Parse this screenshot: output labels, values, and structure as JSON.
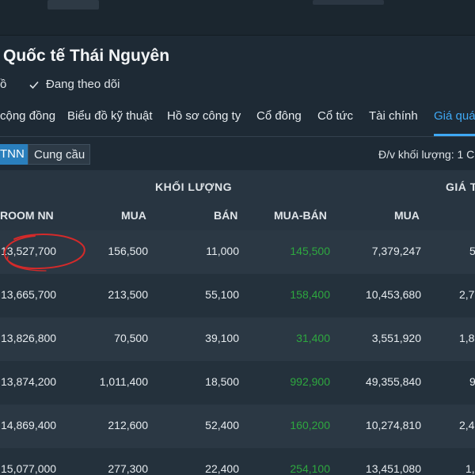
{
  "header": {
    "title": "Quốc tế Thái Nguyên",
    "left_fragment": "ồ",
    "follow_label": "Đang theo dõi"
  },
  "tabs": [
    {
      "label": "cộng đồng",
      "active": false
    },
    {
      "label": "Biểu đồ kỹ thuật",
      "active": false
    },
    {
      "label": "Hồ sơ công ty",
      "active": false
    },
    {
      "label": "Cổ đông",
      "active": false
    },
    {
      "label": "Cổ tức",
      "active": false
    },
    {
      "label": "Tài chính",
      "active": false
    },
    {
      "label": "Giá quá",
      "active": true
    }
  ],
  "segment": {
    "tnn_label": "TNN",
    "cung_cau_label": "Cung cầu",
    "unit_label": "Đ/v khối lượng: 1 C"
  },
  "table": {
    "groups": {
      "volume": "KHỐI LƯỢNG",
      "value": "GIÁ T"
    },
    "columns": [
      "ROOM NN",
      "MUA",
      "BÁN",
      "MUA-BÁN",
      "MUA"
    ],
    "rows": [
      {
        "room": "13,527,700",
        "buy": "156,500",
        "sell": "11,000",
        "net": "145,500",
        "value_buy": "7,379,247",
        "extra": "5"
      },
      {
        "room": "13,665,700",
        "buy": "213,500",
        "sell": "55,100",
        "net": "158,400",
        "value_buy": "10,453,680",
        "extra": "2,7"
      },
      {
        "room": "13,826,800",
        "buy": "70,500",
        "sell": "39,100",
        "net": "31,400",
        "value_buy": "3,551,920",
        "extra": "1,8"
      },
      {
        "room": "13,874,200",
        "buy": "1,011,400",
        "sell": "18,500",
        "net": "992,900",
        "value_buy": "49,355,840",
        "extra": "9"
      },
      {
        "room": "14,869,400",
        "buy": "212,600",
        "sell": "52,400",
        "net": "160,200",
        "value_buy": "10,274,810",
        "extra": "2,4"
      },
      {
        "room": "15,077,000",
        "buy": "277,300",
        "sell": "22,400",
        "net": "254,100",
        "value_buy": "13,451,080",
        "extra": "1,"
      }
    ]
  },
  "colors": {
    "accent": "#3fa9f5",
    "positive": "#2ea83f",
    "annotation": "#d42a2a",
    "background": "#1e2a35"
  }
}
